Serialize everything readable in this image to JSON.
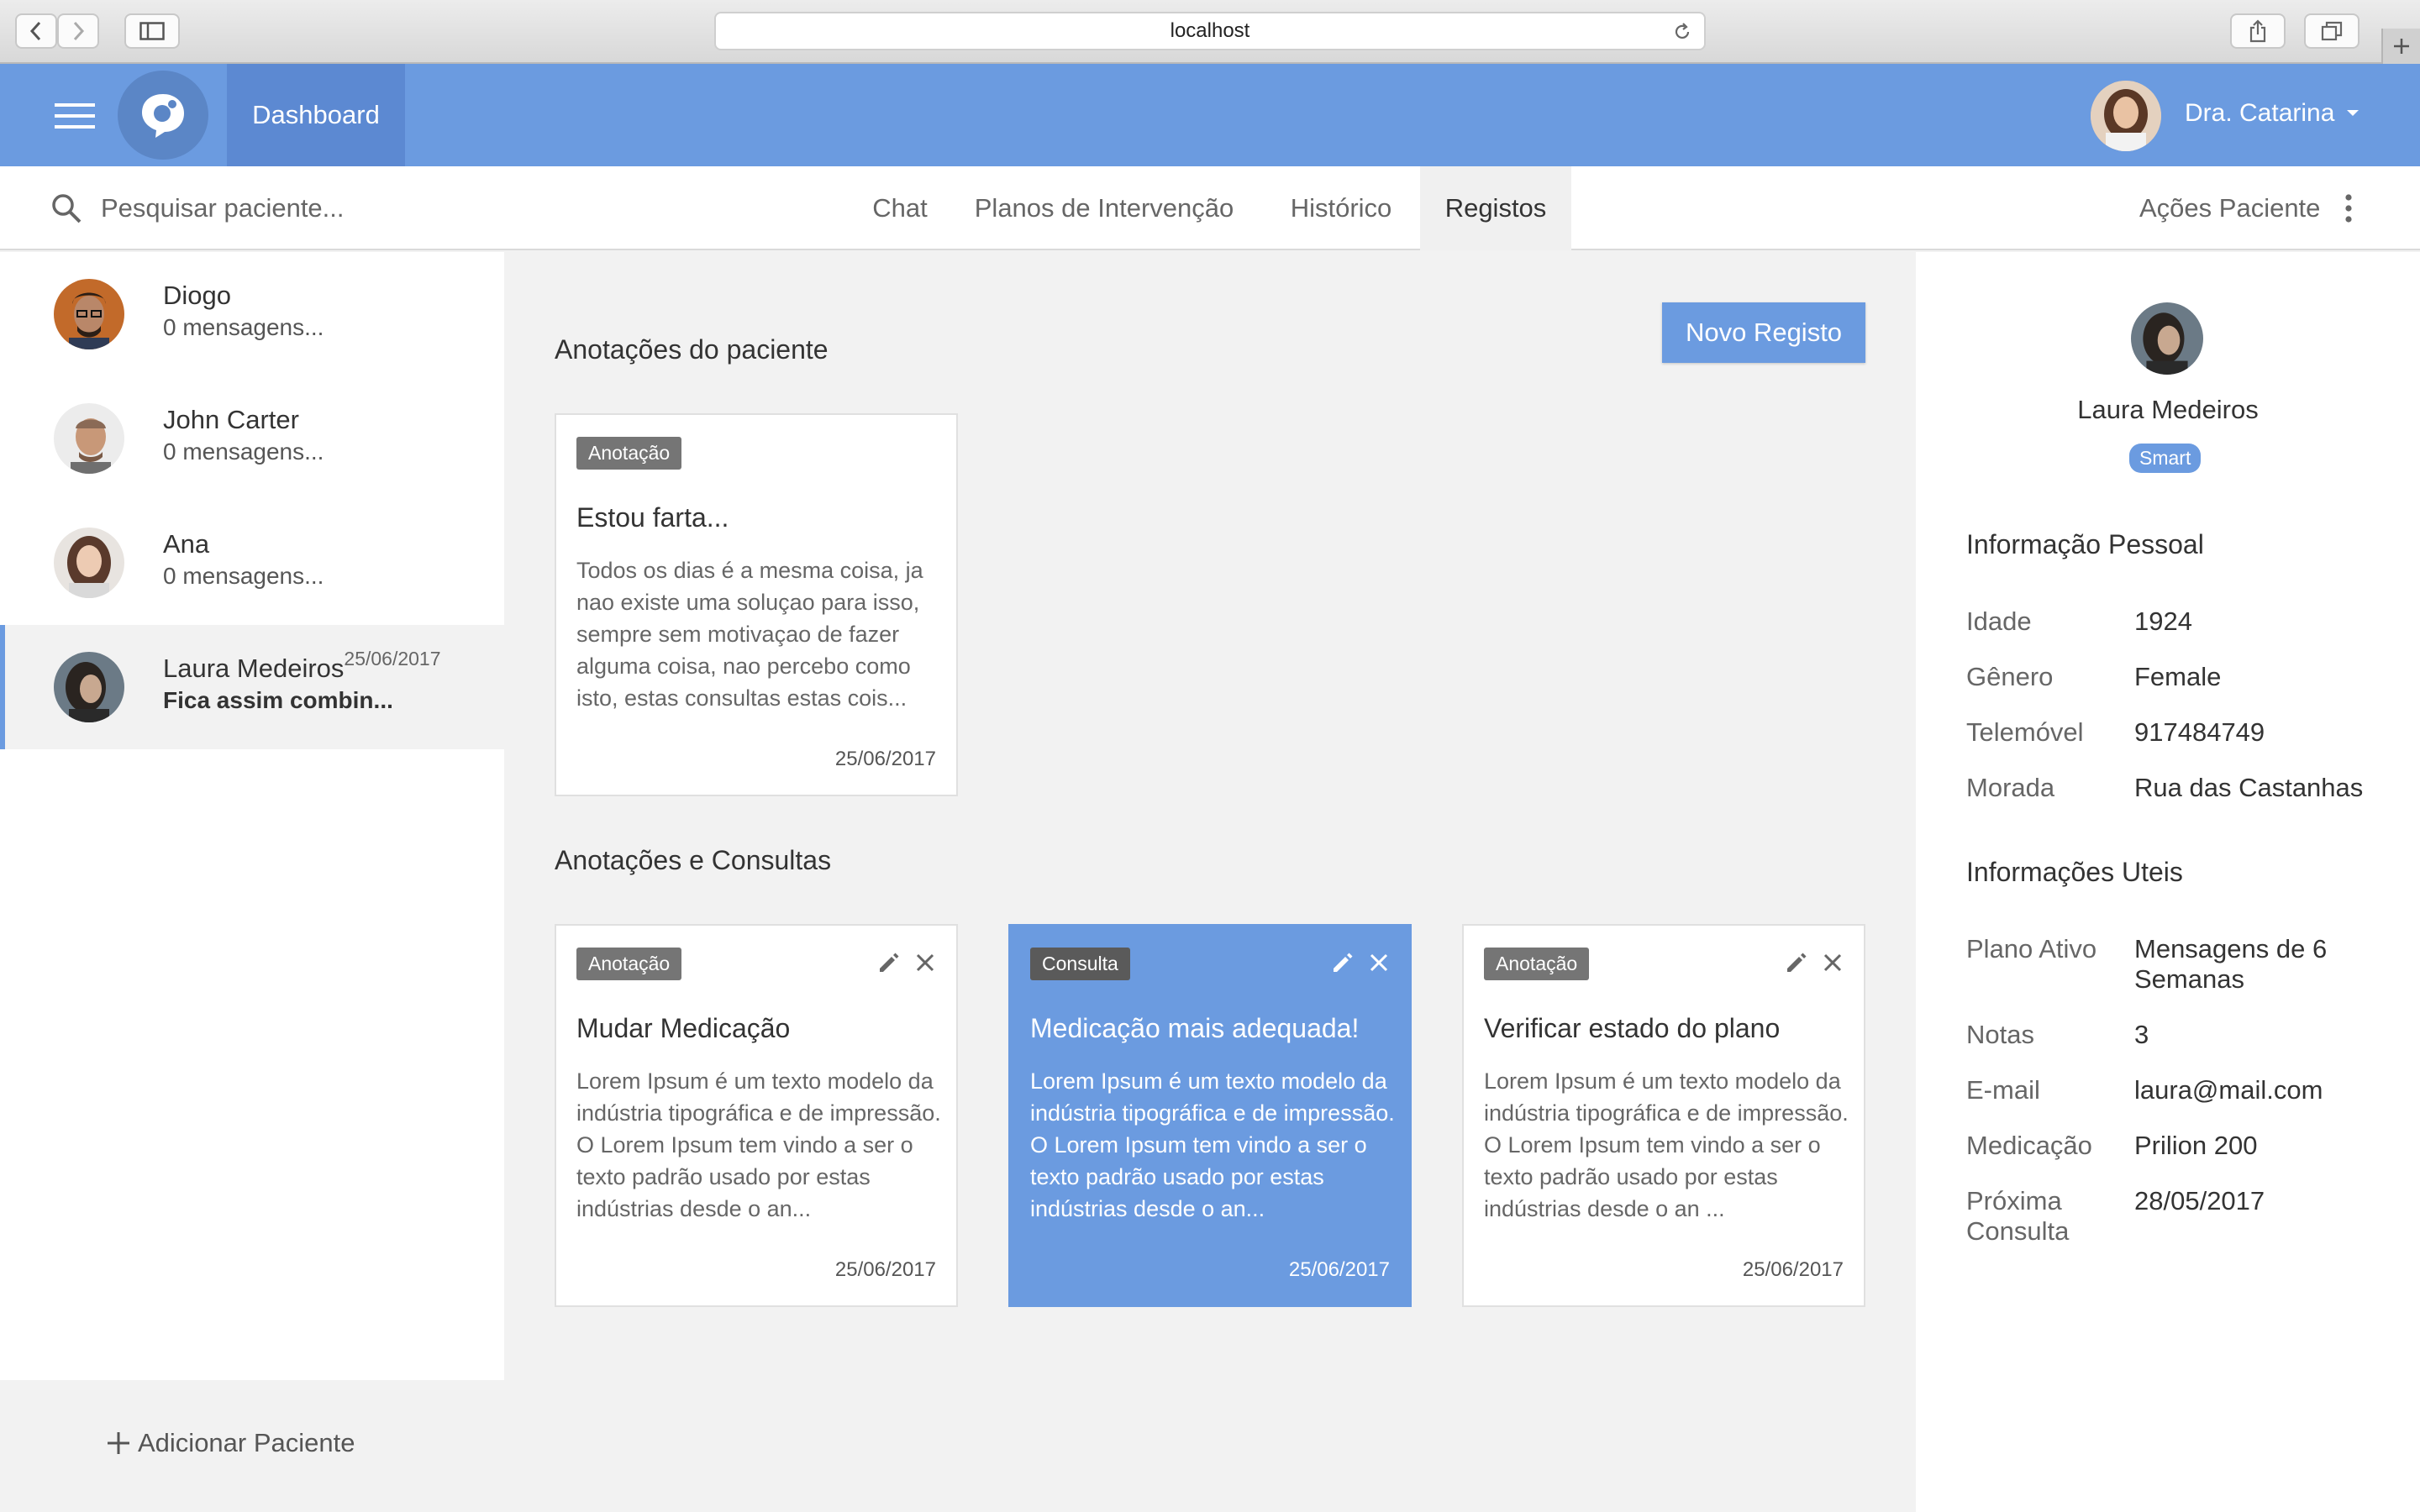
{
  "browser": {
    "url": "localhost"
  },
  "header": {
    "dashboard_label": "Dashboard",
    "user_name": "Dra. Catarina"
  },
  "search": {
    "placeholder": "Pesquisar paciente..."
  },
  "tabs": [
    {
      "label": "Chat"
    },
    {
      "label": "Planos de Intervenção"
    },
    {
      "label": "Histórico"
    },
    {
      "label": "Registos"
    }
  ],
  "active_tab": "Registos",
  "actions_label": "Ações Paciente",
  "patients": [
    {
      "name": "Diogo",
      "message": "0 mensagens...",
      "date": ""
    },
    {
      "name": "John Carter",
      "message": "0 mensagens...",
      "date": ""
    },
    {
      "name": "Ana",
      "message": "0 mensagens...",
      "date": ""
    },
    {
      "name": "Laura Medeiros",
      "message": "Fica assim combin...",
      "date": "25/06/2017"
    }
  ],
  "add_patient_label": "Adicionar Paciente",
  "main": {
    "notes_title": "Anotações do paciente",
    "new_record_label": "Novo Registo",
    "consults_title": "Anotações e Consultas",
    "note_card": {
      "badge": "Anotação",
      "title": "Estou farta...",
      "body": "Todos os dias é a mesma coisa, ja nao existe uma soluçao para isso, sempre sem motivaçao de fazer alguma coisa, nao percebo como isto, estas consultas estas cois...",
      "date": "25/06/2017"
    },
    "cards": [
      {
        "badge": "Anotação",
        "title": "Mudar Medicação",
        "body": "Lorem Ipsum é um texto modelo da indústria tipográfica e de impressão. O Lorem Ipsum tem vindo a ser o texto padrão usado por estas indústrias desde o an...",
        "date": "25/06/2017"
      },
      {
        "badge": "Consulta",
        "title": "Medicação mais adequada!",
        "body": "Lorem Ipsum é um texto modelo da indústria tipográfica e de impressão. O Lorem Ipsum tem vindo a ser o texto padrão usado por estas indústrias desde o an...",
        "date": "25/06/2017"
      },
      {
        "badge": "Anotação",
        "title": "Verificar estado do plano",
        "body": "Lorem Ipsum é um texto modelo da indústria tipográfica e de impressão. O Lorem Ipsum tem vindo a ser o texto padrão usado por estas indústrias desde o an ...",
        "date": "25/06/2017"
      }
    ]
  },
  "profile": {
    "name": "Laura Medeiros",
    "badge": "Smart",
    "personal_title": "Informação Pessoal",
    "personal": [
      {
        "label": "Idade",
        "value": "1924"
      },
      {
        "label": "Gênero",
        "value": "Female"
      },
      {
        "label": "Telemóvel",
        "value": "917484749"
      },
      {
        "label": "Morada",
        "value": "Rua das Castanhas"
      }
    ],
    "useful_title": "Informações Uteis",
    "useful": [
      {
        "label": "Plano Ativo",
        "value": "Mensagens de 6 Semanas"
      },
      {
        "label": "Notas",
        "value": "3"
      },
      {
        "label": "E-mail",
        "value": "laura@mail.com"
      },
      {
        "label": "Medicação",
        "value": "Prilion 200"
      },
      {
        "label": "Próxima Consulta",
        "value": "28/05/2017"
      }
    ]
  },
  "colors": {
    "primary": "#6b9be0",
    "primary_dark": "#5c89d2",
    "badge_gray": "#757575"
  },
  "icons": [
    "back-icon",
    "forward-icon",
    "sidebar-icon",
    "reload-icon",
    "share-icon",
    "tabs-icon",
    "plus-icon",
    "hamburger-icon",
    "logo-icon",
    "dropdown-icon",
    "search-icon",
    "more-vert-icon",
    "pencil-icon",
    "close-icon"
  ]
}
